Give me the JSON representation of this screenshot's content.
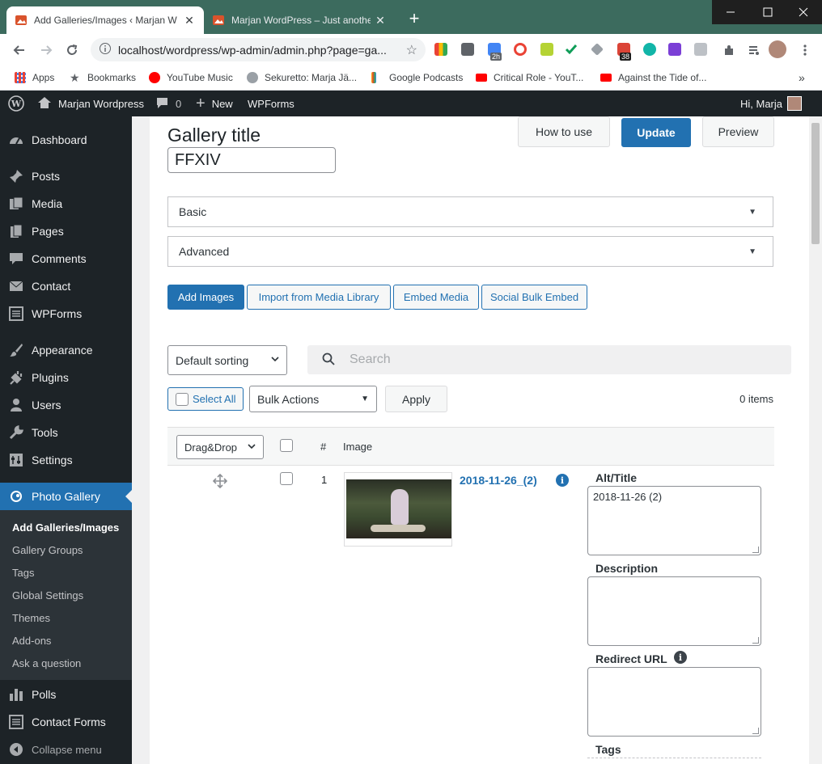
{
  "browser": {
    "tabs": [
      {
        "title": "Add Galleries/Images ‹ Marjan W",
        "active": true
      },
      {
        "title": "Marjan WordPress – Just another",
        "active": false
      }
    ],
    "url": "localhost/wordpress/wp-admin/admin.php?page=ga...",
    "extension_badges": {
      "badge1": "2h",
      "badge2": "38"
    },
    "bookmarks": [
      {
        "label": "Apps",
        "icon": "apps-grid-icon"
      },
      {
        "label": "Bookmarks",
        "icon": "star-icon"
      },
      {
        "label": "YouTube Music",
        "icon": "youtube-music-icon"
      },
      {
        "label": "Sekuretto: Marja Jä...",
        "icon": "globe-icon"
      },
      {
        "label": "Google Podcasts",
        "icon": "google-podcasts-icon"
      },
      {
        "label": "Critical Role - YouT...",
        "icon": "youtube-icon"
      },
      {
        "label": "Against the Tide of...",
        "icon": "youtube-icon"
      }
    ]
  },
  "adminbar": {
    "site_name": "Marjan Wordpress",
    "comments_count": "0",
    "new_label": "New",
    "wpforms_label": "WPForms",
    "greeting": "Hi, Marja"
  },
  "sidebar": {
    "items": [
      {
        "label": "Dashboard",
        "icon": "dashboard-icon"
      },
      {
        "label": "Posts",
        "icon": "pin-icon"
      },
      {
        "label": "Media",
        "icon": "media-icon"
      },
      {
        "label": "Pages",
        "icon": "pages-icon"
      },
      {
        "label": "Comments",
        "icon": "comment-icon"
      },
      {
        "label": "Contact",
        "icon": "mail-icon"
      },
      {
        "label": "WPForms",
        "icon": "form-icon"
      },
      {
        "label": "Appearance",
        "icon": "brush-icon"
      },
      {
        "label": "Plugins",
        "icon": "plugin-icon"
      },
      {
        "label": "Users",
        "icon": "user-icon"
      },
      {
        "label": "Tools",
        "icon": "wrench-icon"
      },
      {
        "label": "Settings",
        "icon": "settings-icon"
      },
      {
        "label": "Photo Gallery",
        "icon": "photo-gallery-icon"
      }
    ],
    "submenu": [
      "Add Galleries/Images",
      "Gallery Groups",
      "Tags",
      "Global Settings",
      "Themes",
      "Add-ons",
      "Ask a question"
    ],
    "after": [
      {
        "label": "Polls",
        "icon": "polls-icon"
      },
      {
        "label": "Contact Forms",
        "icon": "contact-forms-icon"
      },
      {
        "label": "Collapse menu",
        "icon": "collapse-icon"
      }
    ]
  },
  "gallery": {
    "title_label": "Gallery title",
    "title_value": "FFXIV",
    "buttons": {
      "how_to_use": "How to use",
      "update": "Update",
      "preview": "Preview"
    },
    "sections": [
      "Basic",
      "Advanced"
    ],
    "add_buttons": [
      "Add Images",
      "Import from Media Library",
      "Embed Media",
      "Social Bulk Embed"
    ],
    "sorting": "Default sorting",
    "search_placeholder": "Search",
    "select_all": "Select All",
    "bulk_actions": "Bulk Actions",
    "apply": "Apply",
    "items_count": "0 items",
    "table": {
      "order_select": "Drag&Drop",
      "col_number": "#",
      "col_image": "Image"
    },
    "rows": [
      {
        "number": "1",
        "filename": "2018-11-26_(2)",
        "alt_title_label": "Alt/Title",
        "alt_title_value": "2018-11-26 (2)",
        "description_label": "Description",
        "description_value": "",
        "redirect_label": "Redirect URL",
        "redirect_value": "",
        "tags_label": "Tags"
      }
    ]
  },
  "colors": {
    "accent": "#2271b1",
    "admin_dark": "#1d2327",
    "chrome_frame": "#3c6b5e"
  }
}
